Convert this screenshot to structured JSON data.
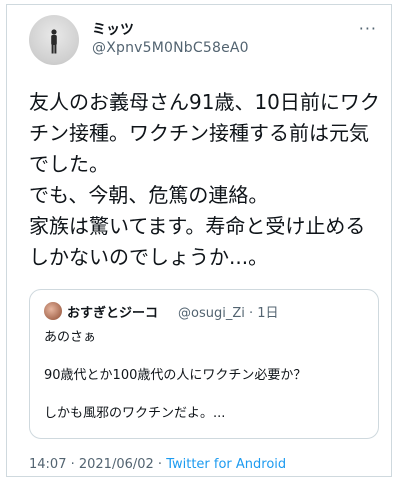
{
  "author": {
    "name": "ミッツ",
    "handle": "@Xpnv5M0NbC58eA0"
  },
  "more_icon": "more-dots-icon",
  "tweet_text": "友人のお義母さん91歳、10日前にワクチン接種。ワクチン接種する前は元気でした。\nでも、今朝、危篤の連絡。\n家族は驚いてます。寿命と受け止めるしかないのでしょうか...。",
  "quote": {
    "name": "おすぎとジーコ",
    "handle_time": "@osugi_Zi · 1日",
    "text": "あのさぁ\n\n90歳代とか100歳代の人にワクチン必要か？\n\nしかも風邪のワクチンだよ。..."
  },
  "meta": {
    "timestamp": "14:07 · 2021/06/02 · ",
    "app": "Twitter for Android"
  },
  "colors": {
    "text": "#0f1419",
    "secondary": "#536471",
    "link": "#1d9bf0",
    "border": "#cfd9de"
  }
}
